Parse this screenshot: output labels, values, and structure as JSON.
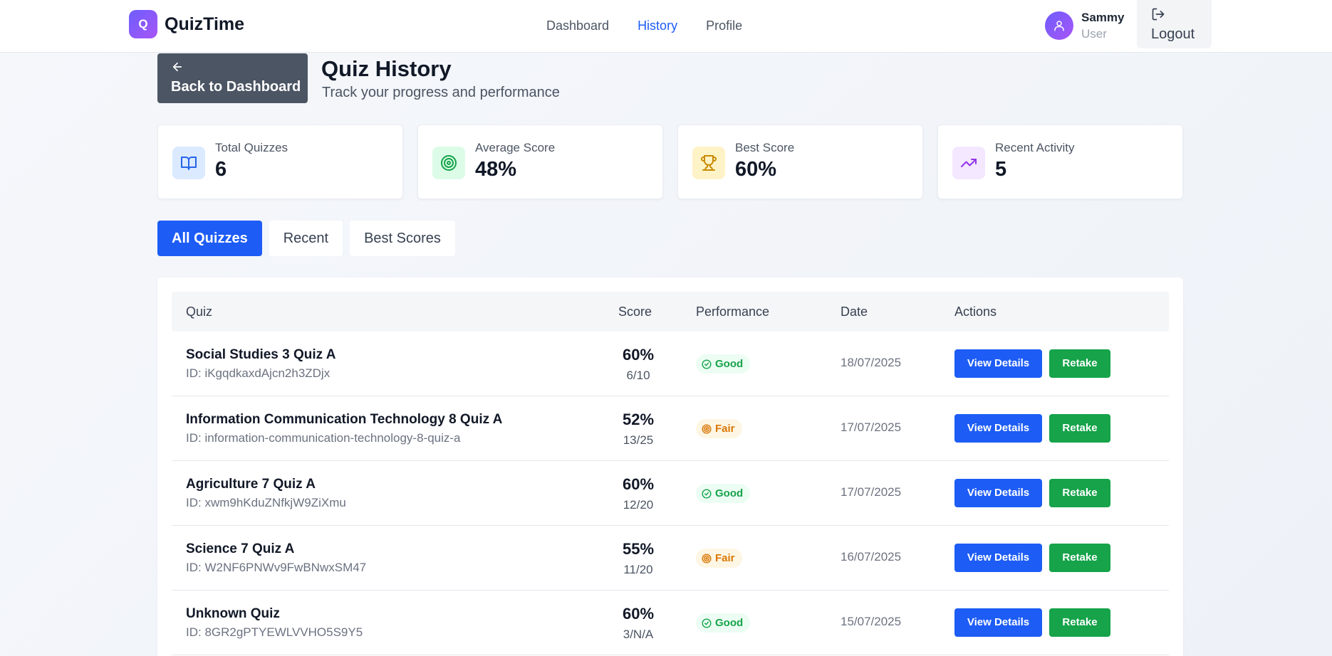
{
  "brand": {
    "logo_letter": "Q",
    "name": "QuizTime",
    "accent": "#6d5dfc"
  },
  "nav": [
    {
      "label": "Dashboard",
      "active": false
    },
    {
      "label": "History",
      "active": true
    },
    {
      "label": "Profile",
      "active": false
    }
  ],
  "user": {
    "name": "Sammy",
    "role": "User",
    "logout_label": "Logout"
  },
  "header": {
    "back_label": "Back to Dashboard",
    "title": "Quiz History",
    "subtitle": "Track your progress and performance"
  },
  "stats": [
    {
      "label": "Total Quizzes",
      "value": "6",
      "icon": "book-open-icon",
      "color": "#2563eb",
      "bg": "#dbeafe"
    },
    {
      "label": "Average Score",
      "value": "48%",
      "icon": "target-icon",
      "color": "#16a34a",
      "bg": "#dcfce7"
    },
    {
      "label": "Best Score",
      "value": "60%",
      "icon": "trophy-icon",
      "color": "#ca8a04",
      "bg": "#fef3c7"
    },
    {
      "label": "Recent Activity",
      "value": "5",
      "icon": "trending-up-icon",
      "color": "#9333ea",
      "bg": "#f3e8ff"
    }
  ],
  "tabs": [
    {
      "label": "All Quizzes",
      "active": true
    },
    {
      "label": "Recent",
      "active": false
    },
    {
      "label": "Best Scores",
      "active": false
    }
  ],
  "table": {
    "headers": {
      "quiz": "Quiz",
      "score": "Score",
      "performance": "Performance",
      "date": "Date",
      "actions": "Actions"
    },
    "rows": [
      {
        "title": "Social Studies 3 Quiz A",
        "id": "ID: iKgqdkaxdAjcn2h3ZDjx",
        "score": "60%",
        "fraction": "6/10",
        "performance": "Good",
        "date": "18/07/2025"
      },
      {
        "title": "Information Communication Technology 8 Quiz A",
        "id": "ID: information-communication-technology-8-quiz-a",
        "score": "52%",
        "fraction": "13/25",
        "performance": "Fair",
        "date": "17/07/2025"
      },
      {
        "title": "Agriculture 7 Quiz A",
        "id": "ID: xwm9hKduZNfkjW9ZiXmu",
        "score": "60%",
        "fraction": "12/20",
        "performance": "Good",
        "date": "17/07/2025"
      },
      {
        "title": "Science 7 Quiz A",
        "id": "ID: W2NF6PNWv9FwBNwxSM47",
        "score": "55%",
        "fraction": "11/20",
        "performance": "Fair",
        "date": "16/07/2025"
      },
      {
        "title": "Unknown Quiz",
        "id": "ID: 8GR2gPTYEWLVVHO5S9Y5",
        "score": "60%",
        "fraction": "3/N/A",
        "performance": "Good",
        "date": "15/07/2025"
      }
    ],
    "view_label": "View Details",
    "retake_label": "Retake"
  }
}
